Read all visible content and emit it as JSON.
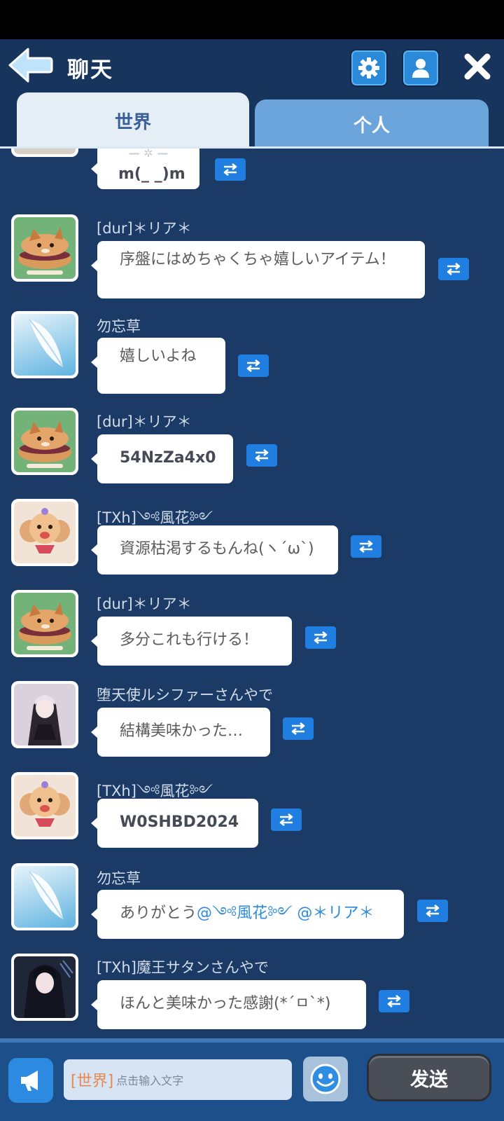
{
  "header": {
    "title": "聊天",
    "icons": {
      "back": "back-arrow-icon",
      "settings": "gear-icon",
      "profile": "person-icon",
      "close": "close-icon"
    }
  },
  "tabs": [
    {
      "label": "世界",
      "active": true
    },
    {
      "label": "个人",
      "active": false
    }
  ],
  "messages": [
    {
      "user": "",
      "text": "m(_ _)m",
      "avatar": "partial"
    },
    {
      "user": "[dur]＊リア＊",
      "text": "序盤にはめちゃくちゃ嬉しいアイテム！",
      "avatar": "shiba-sandwich"
    },
    {
      "user": "勿忘草",
      "text": "嬉しいよね",
      "avatar": "feather"
    },
    {
      "user": "[dur]＊リア＊",
      "text": "54NzZa4x0",
      "avatar": "shiba-sandwich"
    },
    {
      "user": "[TXh]༺風花༻",
      "text": "資源枯渇するもんね(ヽ´ω`)",
      "avatar": "poodle"
    },
    {
      "user": "[dur]＊リア＊",
      "text": "多分これも行ける！",
      "avatar": "shiba-sandwich"
    },
    {
      "user": "堕天使ルシファーさんやで",
      "text": "結構美味かった…",
      "avatar": "dark-girl"
    },
    {
      "user": "[TXh]༺風花༻",
      "text": "W0SHBD2024",
      "avatar": "poodle"
    },
    {
      "user": "勿忘草",
      "text": "ありがとう",
      "mentions": "@༺風花༻ @＊リア＊",
      "avatar": "feather"
    },
    {
      "user": "[TXh]魔王サタンさんやで",
      "text": "ほんと美味かった感謝(*´ㅁ`*)",
      "avatar": "dark-girl"
    }
  ],
  "input": {
    "channel": "[世界]",
    "placeholder": "点击输入文字"
  },
  "send_label": "发送",
  "colors": {
    "background": "#1b3a66",
    "accent": "#1f7ee0",
    "mention": "#2b8ae0"
  }
}
